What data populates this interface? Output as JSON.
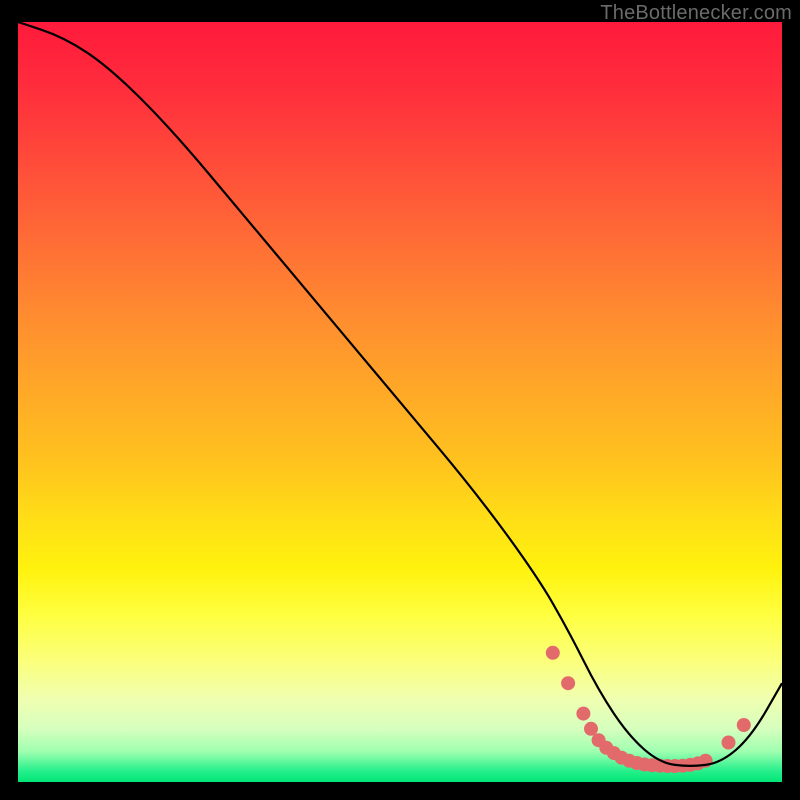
{
  "watermark": "TheBottlenecker.com",
  "chart_data": {
    "type": "line",
    "title": "",
    "xlabel": "",
    "ylabel": "",
    "xlim": [
      0,
      100
    ],
    "ylim": [
      0,
      100
    ],
    "series": [
      {
        "name": "curve",
        "x": [
          0,
          6,
          12,
          20,
          30,
          40,
          50,
          60,
          68,
          72,
          76,
          80,
          84,
          88,
          92,
          96,
          100
        ],
        "y": [
          100,
          98,
          94,
          86,
          74,
          62,
          50,
          38,
          27,
          20,
          12,
          6,
          2.5,
          2,
          2.5,
          6,
          13
        ]
      }
    ],
    "markers": {
      "name": "highlight-dots",
      "color": "#e26a6a",
      "points_x": [
        70,
        72,
        74,
        75,
        76,
        77,
        78,
        79,
        80,
        81,
        82,
        83,
        84,
        85,
        86,
        87,
        88,
        89,
        90,
        93,
        95
      ],
      "points_y": [
        17,
        13,
        9,
        7,
        5.5,
        4.5,
        3.8,
        3.2,
        2.8,
        2.5,
        2.3,
        2.2,
        2.15,
        2.1,
        2.1,
        2.15,
        2.25,
        2.45,
        2.8,
        5.2,
        7.5
      ]
    }
  }
}
